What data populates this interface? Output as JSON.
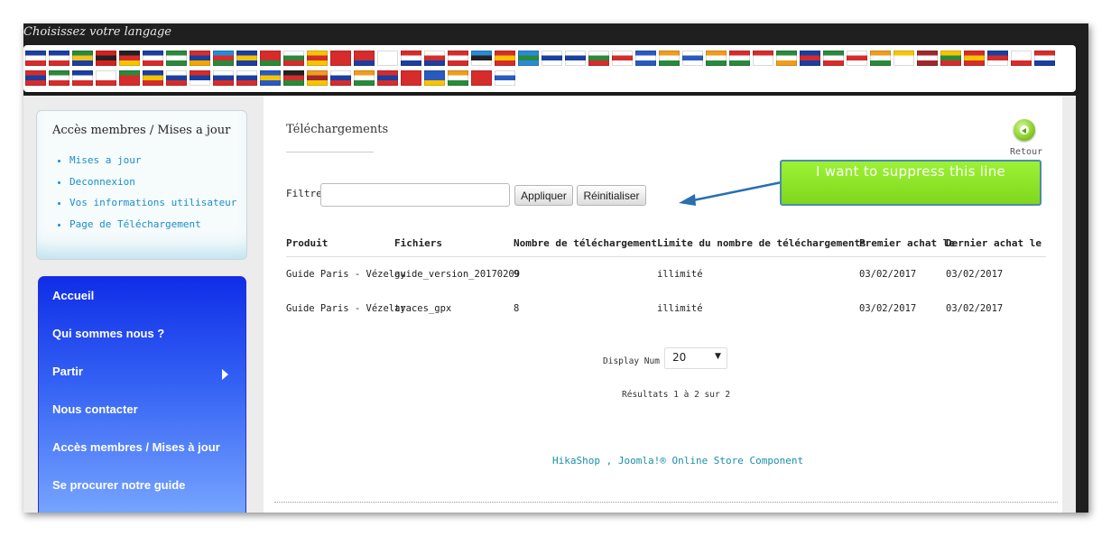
{
  "language_bar": {
    "title": "Choisissez votre langage",
    "flags_row1": [
      {
        "name": "flag-fr",
        "colors": [
          "#1b3fa0",
          "#ffffff",
          "#d62c2c"
        ]
      },
      {
        "name": "flag-fr-2",
        "colors": [
          "#1b3fa0",
          "#ffffff",
          "#d62c2c"
        ]
      },
      {
        "name": "flag-za",
        "colors": [
          "#2a8a3c",
          "#f2c31c",
          "#1b3fa0"
        ]
      },
      {
        "name": "flag-al",
        "colors": [
          "#d6201f",
          "#222222",
          "#d6201f"
        ]
      },
      {
        "name": "flag-de",
        "colors": [
          "#222222",
          "#d62c2c",
          "#f7c500"
        ]
      },
      {
        "name": "flag-gb",
        "colors": [
          "#1b3fa0",
          "#ffffff",
          "#d62c2c"
        ]
      },
      {
        "name": "flag-sa",
        "colors": [
          "#2a8a3c",
          "#ffffff",
          "#2a8a3c"
        ]
      },
      {
        "name": "flag-am",
        "colors": [
          "#d62c2c",
          "#1b3fa0",
          "#f2a800"
        ]
      },
      {
        "name": "flag-az",
        "colors": [
          "#2a8ad6",
          "#d62c2c",
          "#2a8a3c"
        ]
      },
      {
        "name": "flag-ba",
        "colors": [
          "#1b3fa0",
          "#f7c500",
          "#1b3fa0"
        ]
      },
      {
        "name": "flag-by",
        "colors": [
          "#d62c2c",
          "#d62c2c",
          "#2a8a3c"
        ]
      },
      {
        "name": "flag-bg",
        "colors": [
          "#ffffff",
          "#2a8a3c",
          "#d62c2c"
        ]
      },
      {
        "name": "flag-ca",
        "colors": [
          "#f7c500",
          "#d62c2c",
          "#f7c500"
        ]
      },
      {
        "name": "flag-cn",
        "colors": [
          "#d62c2c",
          "#d62c2c",
          "#d62c2c"
        ]
      },
      {
        "name": "flag-tw",
        "colors": [
          "#d62c2c",
          "#d62c2c",
          "#1b3fa0"
        ]
      },
      {
        "name": "flag-kr",
        "colors": [
          "#ffffff",
          "#ffffff",
          "#ffffff"
        ]
      },
      {
        "name": "flag-hr",
        "colors": [
          "#d62c2c",
          "#ffffff",
          "#1b3fa0"
        ]
      },
      {
        "name": "flag-cz",
        "colors": [
          "#ffffff",
          "#d62c2c",
          "#1b3fa0"
        ]
      },
      {
        "name": "flag-dk",
        "colors": [
          "#d62c2c",
          "#ffffff",
          "#d62c2c"
        ]
      },
      {
        "name": "flag-ee",
        "colors": [
          "#2a8ad6",
          "#222222",
          "#ffffff"
        ]
      },
      {
        "name": "flag-es",
        "colors": [
          "#d62c2c",
          "#f7c500",
          "#d62c2c"
        ]
      },
      {
        "name": "flag-world",
        "colors": [
          "#2a8ad6",
          "#2a8a3c",
          "#2a8ad6"
        ]
      },
      {
        "name": "flag-fi",
        "colors": [
          "#ffffff",
          "#1b3fa0",
          "#ffffff"
        ]
      },
      {
        "name": "flag-pin",
        "colors": [
          "#ffffff",
          "#1b3fa0",
          "#ffffff"
        ]
      },
      {
        "name": "flag-wales",
        "colors": [
          "#ffffff",
          "#2a8a3c",
          "#d62c2c"
        ]
      },
      {
        "name": "flag-ge",
        "colors": [
          "#ffffff",
          "#d62c2c",
          "#ffffff"
        ]
      },
      {
        "name": "flag-gr",
        "colors": [
          "#2a5ac0",
          "#ffffff",
          "#2a5ac0"
        ]
      },
      {
        "name": "flag-in",
        "colors": [
          "#f29c1c",
          "#ffffff",
          "#2a8a3c"
        ]
      },
      {
        "name": "flag-il",
        "colors": [
          "#ffffff",
          "#2a5ac0",
          "#ffffff"
        ]
      },
      {
        "name": "flag-in-2",
        "colors": [
          "#f29c1c",
          "#ffffff",
          "#2a8a3c"
        ]
      },
      {
        "name": "flag-hu",
        "colors": [
          "#d62c2c",
          "#ffffff",
          "#2a8a3c"
        ]
      },
      {
        "name": "flag-id",
        "colors": [
          "#d62c2c",
          "#ffffff",
          "#ffffff"
        ]
      },
      {
        "name": "flag-ie",
        "colors": [
          "#2a8a3c",
          "#ffffff",
          "#f29c1c"
        ]
      },
      {
        "name": "flag-is",
        "colors": [
          "#1b3fa0",
          "#d62c2c",
          "#1b3fa0"
        ]
      },
      {
        "name": "flag-it",
        "colors": [
          "#2a8a3c",
          "#ffffff",
          "#d62c2c"
        ]
      },
      {
        "name": "flag-jp",
        "colors": [
          "#ffffff",
          "#d62c2c",
          "#ffffff"
        ]
      },
      {
        "name": "flag-in-3",
        "colors": [
          "#f29c1c",
          "#ffffff",
          "#2a8a3c"
        ]
      },
      {
        "name": "flag-va",
        "colors": [
          "#f7c500",
          "#ffffff",
          "#ffffff"
        ]
      },
      {
        "name": "flag-lv",
        "colors": [
          "#a0282c",
          "#ffffff",
          "#a0282c"
        ]
      },
      {
        "name": "flag-lt",
        "colors": [
          "#f7c500",
          "#2a8a3c",
          "#d62c2c"
        ]
      },
      {
        "name": "flag-mk",
        "colors": [
          "#d62c2c",
          "#f7c500",
          "#d62c2c"
        ]
      },
      {
        "name": "flag-my",
        "colors": [
          "#1b3fa0",
          "#d62c2c",
          "#ffffff"
        ]
      },
      {
        "name": "flag-mt",
        "colors": [
          "#ffffff",
          "#ffffff",
          "#d62c2c"
        ]
      },
      {
        "name": "flag-nl",
        "colors": [
          "#d62c2c",
          "#ffffff",
          "#1b3fa0"
        ]
      }
    ],
    "flags_row2": [
      {
        "name": "flag-no",
        "colors": [
          "#d62c2c",
          "#1b3fa0",
          "#d62c2c"
        ]
      },
      {
        "name": "flag-ir",
        "colors": [
          "#2a8a3c",
          "#ffffff",
          "#d62c2c"
        ]
      },
      {
        "name": "flag-ph",
        "colors": [
          "#1b3fa0",
          "#ffffff",
          "#d62c2c"
        ]
      },
      {
        "name": "flag-pl",
        "colors": [
          "#ffffff",
          "#ffffff",
          "#d62c2c"
        ]
      },
      {
        "name": "flag-pt",
        "colors": [
          "#2a8a3c",
          "#d62c2c",
          "#d62c2c"
        ]
      },
      {
        "name": "flag-ro",
        "colors": [
          "#1b3fa0",
          "#f7c500",
          "#d62c2c"
        ]
      },
      {
        "name": "flag-ru",
        "colors": [
          "#ffffff",
          "#1b3fa0",
          "#d62c2c"
        ]
      },
      {
        "name": "flag-rs",
        "colors": [
          "#d62c2c",
          "#1b3fa0",
          "#ffffff"
        ]
      },
      {
        "name": "flag-sk",
        "colors": [
          "#ffffff",
          "#1b3fa0",
          "#d62c2c"
        ]
      },
      {
        "name": "flag-si",
        "colors": [
          "#ffffff",
          "#1b3fa0",
          "#d62c2c"
        ]
      },
      {
        "name": "flag-se",
        "colors": [
          "#2a5ac0",
          "#f7c500",
          "#2a5ac0"
        ]
      },
      {
        "name": "flag-ke",
        "colors": [
          "#222222",
          "#d62c2c",
          "#2a8a3c"
        ]
      },
      {
        "name": "flag-lk",
        "colors": [
          "#f29c1c",
          "#a0282c",
          "#f7c500"
        ]
      },
      {
        "name": "flag-cz-2",
        "colors": [
          "#ffffff",
          "#1b3fa0",
          "#d62c2c"
        ]
      },
      {
        "name": "flag-in-4",
        "colors": [
          "#f29c1c",
          "#ffffff",
          "#2a8a3c"
        ]
      },
      {
        "name": "flag-th",
        "colors": [
          "#d62c2c",
          "#1b3fa0",
          "#d62c2c"
        ]
      },
      {
        "name": "flag-tr",
        "colors": [
          "#d62c2c",
          "#d62c2c",
          "#d62c2c"
        ]
      },
      {
        "name": "flag-ua",
        "colors": [
          "#2a5ac0",
          "#2a5ac0",
          "#f7c500"
        ]
      },
      {
        "name": "flag-in-5",
        "colors": [
          "#f29c1c",
          "#ffffff",
          "#2a8a3c"
        ]
      },
      {
        "name": "flag-vn",
        "colors": [
          "#d62c2c",
          "#d62c2c",
          "#d62c2c"
        ]
      },
      {
        "name": "flag-il-2",
        "colors": [
          "#ffffff",
          "#2a5ac0",
          "#ffffff"
        ]
      }
    ]
  },
  "sidebar": {
    "box_title": "Accès membres / Mises a jour",
    "links": [
      "Mises a jour",
      "Deconnexion",
      "Vos informations utilisateur",
      "Page de Téléchargement"
    ],
    "menu": [
      "Accueil",
      "Qui sommes nous ?",
      "Partir",
      "Nous contacter",
      "Accès membres / Mises à jour",
      "Se procurer notre guide"
    ]
  },
  "main": {
    "title": "Téléchargements",
    "back_label": "Retour",
    "filter_label": "Filtre:",
    "filter_value": "",
    "apply_label": "Appliquer",
    "reset_label": "Réinitialiser",
    "columns": [
      "Produit",
      "Fichiers",
      "Nombre de téléchargement",
      "Limite du nombre de téléchargements",
      "Premier achat le",
      "Dernier achat le"
    ],
    "rows": [
      [
        "Guide Paris - Vézelay",
        "guide_version_20170209",
        "9",
        "illimité",
        "03/02/2017",
        "03/02/2017"
      ],
      [
        "Guide Paris - Vézelay",
        "traces_gpx",
        "8",
        "illimité",
        "03/02/2017",
        "03/02/2017"
      ]
    ],
    "display_num_label": "Display Num",
    "display_num_value": "20",
    "results": "Résultats 1 à 2 sur 2",
    "footer_link": "HikaShop , Joomla!® Online Store Component"
  },
  "annotation": {
    "callout_text": "I want to suppress this line",
    "callout_color": "#8ee02a",
    "arrow_color": "#2a6fb0"
  }
}
